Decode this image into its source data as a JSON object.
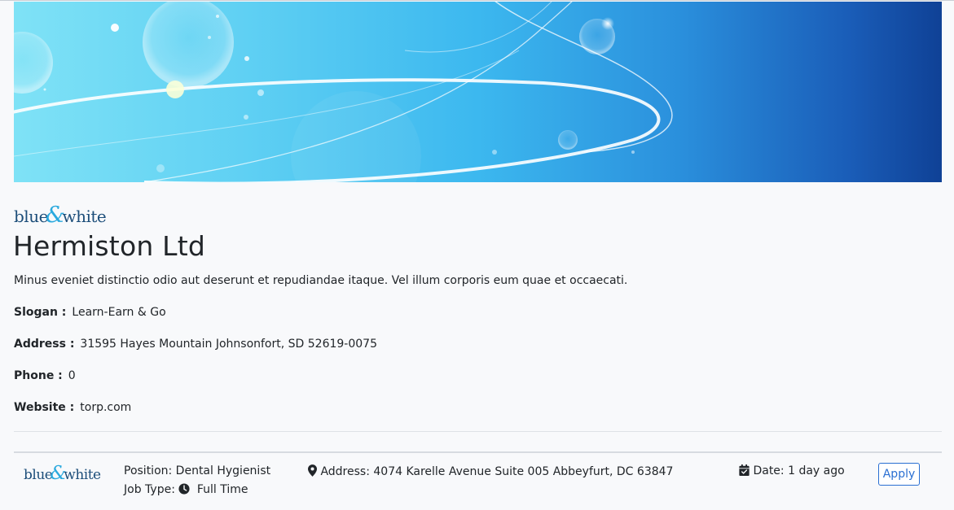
{
  "company": {
    "logo": {
      "part1": "blue",
      "amp": "&",
      "part2": "white"
    },
    "name": "Hermiston Ltd",
    "description": "Minus eveniet distinctio odio aut deserunt et repudiandae itaque. Vel illum corporis eum quae et occaecati.",
    "slogan": {
      "label": "Slogan :",
      "value": "Learn-Earn & Go"
    },
    "address": {
      "label": "Address :",
      "value": "31595 Hayes Mountain Johnsonfort, SD 52619-0075"
    },
    "phone": {
      "label": "Phone :",
      "value": "0"
    },
    "website": {
      "label": "Website :",
      "value": "torp.com"
    }
  },
  "job": {
    "logo": {
      "part1": "blue",
      "amp": "&",
      "part2": "white"
    },
    "position": "Position: Dental Hygienist",
    "job_type_label": "Job Type:",
    "job_type_value": "Full Time",
    "address": "Address: 4074 Karelle Avenue Suite 005 Abbeyfurt, DC 63847",
    "date": "Date: 1 day ago",
    "apply_label": "Apply"
  },
  "icons": {
    "address": "map-marker-icon",
    "date": "calendar-check-icon",
    "job_type": "clock-icon"
  },
  "colors": {
    "accent": "#2a6fd2",
    "banner_start": "#7fe2f6",
    "banner_end": "#0f4196",
    "text": "#212529"
  }
}
